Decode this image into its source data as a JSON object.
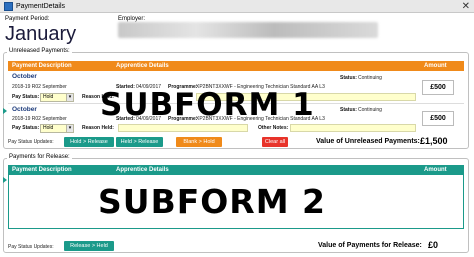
{
  "window": {
    "title": "PaymentDetails",
    "close_glyph": "✕"
  },
  "header": {
    "period_label": "Payment Period:",
    "period_value": "January",
    "employer_label": "Employer:"
  },
  "unreleased": {
    "group_title": "Unreleased Payments:",
    "columns": {
      "description": "Payment Description",
      "apprentice": "Apprentice Details",
      "amount": "Amount"
    },
    "rows": [
      {
        "month": "October",
        "description": "2018-19 R02 September",
        "started_label": "Started:",
        "started_value": "04/09/2017",
        "programme_label": "Programme:",
        "programme_value": "XP2BNT3XXWF - Engineering Technician Standard AA L3",
        "status_label": "Status:",
        "status_value": "Continuing",
        "pay_status_label": "Pay Status:",
        "pay_status_value": "Hold",
        "reason_held_label": "Reason Held:",
        "other_notes_label": "Other Notes:",
        "amount": "£500"
      },
      {
        "month": "October",
        "description": "2018-19 R02 September",
        "started_label": "Started:",
        "started_value": "04/09/2017",
        "programme_label": "Programme:",
        "programme_value": "XP2BNT3XXWF - Engineering Technician Standard AA L3",
        "status_label": "Status:",
        "status_value": "Continuing",
        "pay_status_label": "Pay Status:",
        "pay_status_value": "Hold",
        "reason_held_label": "Reason Held:",
        "other_notes_label": "Other Notes:",
        "amount": "£500"
      }
    ],
    "overlay_text": "SUBFORM 1",
    "pay_status_updates_label": "Pay Status Updates:",
    "buttons": {
      "hold_release": "Hold > Release",
      "held_release": "Held > Release",
      "blank_hold": "Blank > Hold",
      "clear_all": "Clear all"
    },
    "value_label": "Value of Unreleased Payments:",
    "value_amount": "£1,500"
  },
  "release": {
    "group_title": "Payments for Release:",
    "columns": {
      "description": "Payment Description",
      "apprentice": "Apprentice Details",
      "amount": "Amount"
    },
    "overlay_text": "SUBFORM 2",
    "pay_status_updates_label": "Pay Status Updates:",
    "buttons": {
      "release_held": "Release > Held"
    },
    "value_label": "Value of Payments for Release:",
    "value_amount": "£0"
  },
  "colors": {
    "orange": "#f08a1a",
    "teal": "#1b9a8a",
    "red": "#e8332a",
    "field_yellow": "#ffffcc"
  },
  "icons": [
    "app-icon",
    "close-icon",
    "dropdown-arrow-icon",
    "record-selector-arrow-icon"
  ]
}
